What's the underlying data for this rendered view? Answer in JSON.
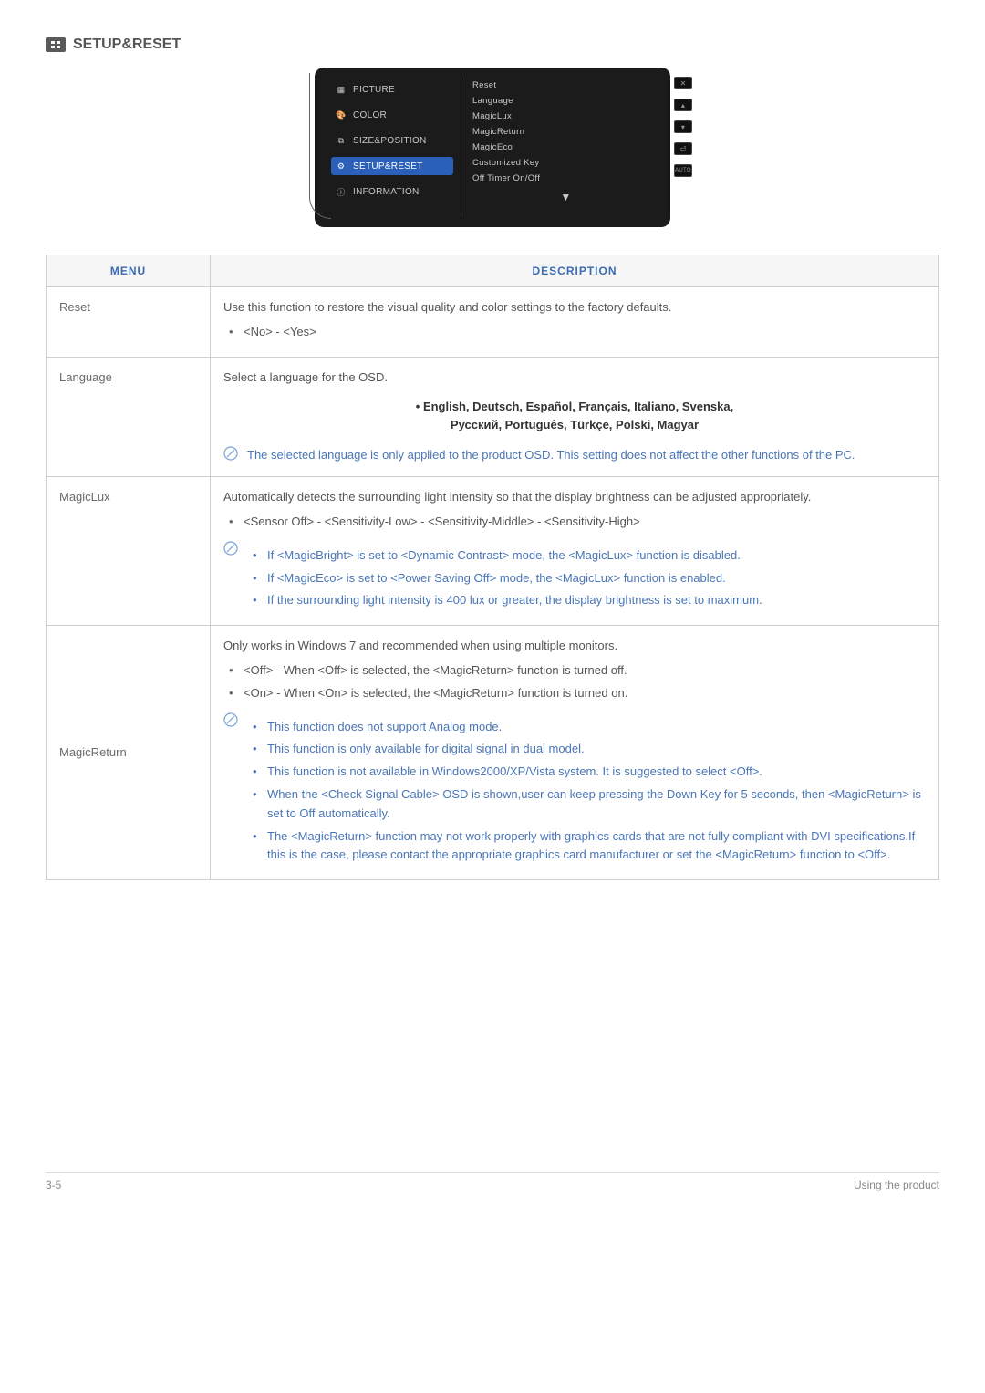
{
  "heading": "SETUP&RESET",
  "osd": {
    "left": [
      "PICTURE",
      "COLOR",
      "SIZE&POSITION",
      "SETUP&RESET",
      "INFORMATION"
    ],
    "right": [
      "Reset",
      "Language",
      "MagicLux",
      "MagicReturn",
      "MagicEco",
      "Customized Key",
      "Off Timer On/Off"
    ],
    "arrow": "▼",
    "btns": {
      "x": "✕",
      "up": "▴",
      "down": "▾",
      "enter": "⏎",
      "auto": "AUTO"
    }
  },
  "table": {
    "head": {
      "menu": "MENU",
      "desc": "DESCRIPTION"
    },
    "reset": {
      "label": "Reset",
      "intro": "Use this function to restore the visual quality and color settings to the factory defaults.",
      "opts": "<No> - <Yes>"
    },
    "language": {
      "label": "Language",
      "intro": "Select a language for the OSD.",
      "langs_line1": "• English, Deutsch, Español, Français, Italiano, Svenska,",
      "langs_line2": "Русский, Português, Türkçe, Polski, Magyar",
      "note": "The selected language is only applied to the product OSD. This setting does not affect the other functions of the PC."
    },
    "magiclux": {
      "label": "MagicLux",
      "intro": "Automatically detects the surrounding light intensity so that the display brightness can be adjusted appropriately.",
      "opts": "<Sensor Off> - <Sensitivity-Low> - <Sensitivity-Middle> - <Sensitivity-High>",
      "notes": [
        "If <MagicBright> is set to <Dynamic Contrast> mode, the <MagicLux> function is disabled.",
        "If <MagicEco> is set to <Power Saving Off> mode, the <MagicLux> function is enabled.",
        "If the surrounding light intensity is 400 lux or greater, the display brightness is set to maximum."
      ]
    },
    "magicreturn": {
      "label": "MagicReturn",
      "intro": "Only works in Windows 7 and recommended when using multiple monitors.",
      "items": [
        "<Off> - When <Off> is selected, the <MagicReturn> function is turned off.",
        "<On> - When <On> is selected, the <MagicReturn> function is turned on."
      ],
      "notes": [
        "This function does not support Analog mode.",
        "This function is only available for digital signal in dual model.",
        "This function is not available in Windows2000/XP/Vista system. It is suggested to select <Off>.",
        "When the <Check Signal Cable> OSD is shown,user can keep pressing the Down Key for 5 seconds, then <MagicReturn> is set to Off automatically.",
        "The <MagicReturn> function may not work properly with graphics cards that are not fully compliant with DVI specifications.If this is the case, please contact the appropriate graphics card manufacturer or set the <MagicReturn> function to <Off>."
      ]
    }
  },
  "footer": {
    "left": "3-5",
    "right": "Using the product"
  }
}
